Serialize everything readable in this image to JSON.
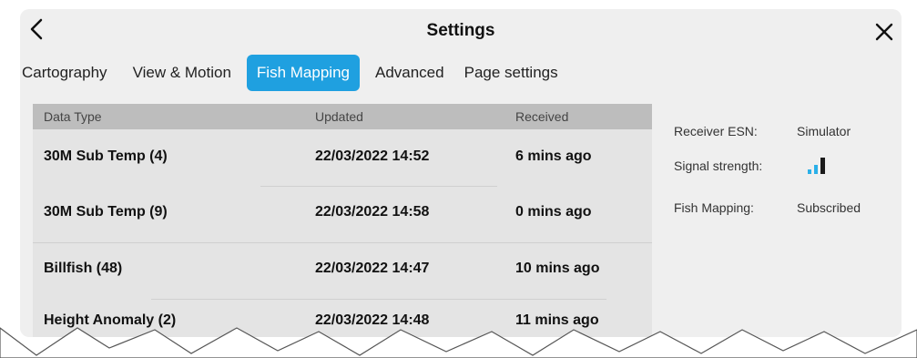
{
  "header": {
    "title": "Settings",
    "back_icon": "chevron-left-icon",
    "close_icon": "close-icon"
  },
  "tabs": [
    {
      "label": "Cartography",
      "active": false
    },
    {
      "label": "View & Motion",
      "active": false
    },
    {
      "label": "Fish Mapping",
      "active": true
    },
    {
      "label": "Advanced",
      "active": false
    },
    {
      "label": "Page settings",
      "active": false
    }
  ],
  "table": {
    "columns": [
      "Data Type",
      "Updated",
      "Received"
    ],
    "rows": [
      {
        "type": "30M Sub Temp (4)",
        "updated": "22/03/2022 14:52",
        "received": "6 mins ago"
      },
      {
        "type": "30M Sub Temp (9)",
        "updated": "22/03/2022 14:58",
        "received": "0 mins ago"
      },
      {
        "type": "Billfish (48)",
        "updated": "22/03/2022 14:47",
        "received": "10 mins ago"
      },
      {
        "type": "Height Anomaly (2)",
        "updated": "22/03/2022 14:48",
        "received": "11 mins ago"
      }
    ]
  },
  "info": {
    "receiver_esn_label": "Receiver ESN:",
    "receiver_esn_value": "Simulator",
    "signal_strength_label": "Signal strength:",
    "signal_icon": "signal-bars-icon",
    "fish_mapping_label": "Fish Mapping:",
    "fish_mapping_value": "Subscribed"
  },
  "colors": {
    "accent": "#1fa0e0",
    "panel": "#efefef",
    "table_header": "#bdbdbd",
    "table_body": "#e4e4e4"
  }
}
